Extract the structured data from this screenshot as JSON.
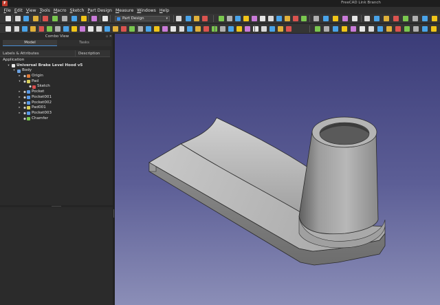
{
  "window": {
    "title": "FreeCAD Link Branch"
  },
  "menu": [
    {
      "pre": "",
      "u": "F",
      "post": "ile"
    },
    {
      "pre": "",
      "u": "E",
      "post": "dit"
    },
    {
      "pre": "",
      "u": "V",
      "post": "iew"
    },
    {
      "pre": "",
      "u": "T",
      "post": "ools"
    },
    {
      "pre": "",
      "u": "M",
      "post": "acro"
    },
    {
      "pre": "",
      "u": "S",
      "post": "ketch"
    },
    {
      "pre": "",
      "u": "P",
      "post": "art Design"
    },
    {
      "pre": "",
      "u": "M",
      "post": "easure"
    },
    {
      "pre": "",
      "u": "W",
      "post": "indows"
    },
    {
      "pre": "",
      "u": "H",
      "post": "elp"
    }
  ],
  "workbench": {
    "selected": "Part Design"
  },
  "combo_view": {
    "title": "Combo View",
    "tabs": [
      "Model",
      "Tasks"
    ],
    "active_tab": "Model",
    "columns": [
      "Labels & Attributes",
      "Description"
    ],
    "tree": [
      {
        "label": "Application",
        "depth": 0,
        "arrow": "",
        "icon": "none"
      },
      {
        "label": "Universal Brake Level Hood v5",
        "depth": 1,
        "arrow": "▾",
        "icon": "document-icon",
        "bold": true
      },
      {
        "label": "Body",
        "depth": 2,
        "arrow": "▾",
        "icon": "body-icon"
      },
      {
        "label": "Origin",
        "depth": 3,
        "arrow": "▸",
        "icon": "origin-icon"
      },
      {
        "label": "Pad",
        "depth": 3,
        "arrow": "▾",
        "icon": "pad-icon"
      },
      {
        "label": "Sketch",
        "depth": 4,
        "arrow": "",
        "icon": "sketch-icon"
      },
      {
        "label": "Pocket",
        "depth": 3,
        "arrow": "▸",
        "icon": "pocket-icon"
      },
      {
        "label": "Pocket001",
        "depth": 3,
        "arrow": "▸",
        "icon": "pocket-icon"
      },
      {
        "label": "Pocket002",
        "depth": 3,
        "arrow": "▸",
        "icon": "pocket-icon"
      },
      {
        "label": "Pad001",
        "depth": 3,
        "arrow": "▸",
        "icon": "pad-icon"
      },
      {
        "label": "Pocket003",
        "depth": 3,
        "arrow": "▸",
        "icon": "pocket-icon"
      },
      {
        "label": "Chamfer",
        "depth": 3,
        "arrow": "",
        "icon": "chamfer-icon"
      }
    ]
  },
  "colors": {
    "accent": "#4a90d9",
    "viewport_top": "#3b3c78",
    "viewport_bottom": "#8b8eb7",
    "model_face": "#b9b9b9"
  }
}
